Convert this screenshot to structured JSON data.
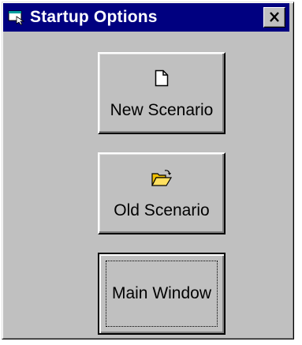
{
  "window": {
    "title": "Startup Options",
    "close_label": "✕",
    "icon": "app-window-icon"
  },
  "buttons": {
    "new_scenario": {
      "label": "New Scenario",
      "icon": "new-document-icon"
    },
    "old_scenario": {
      "label": "Old Scenario",
      "icon": "open-folder-icon"
    },
    "main_window": {
      "label": "Main Window"
    }
  },
  "colors": {
    "titlebar": "#000080",
    "face": "#c0c0c0",
    "folder": "#f0c000"
  }
}
